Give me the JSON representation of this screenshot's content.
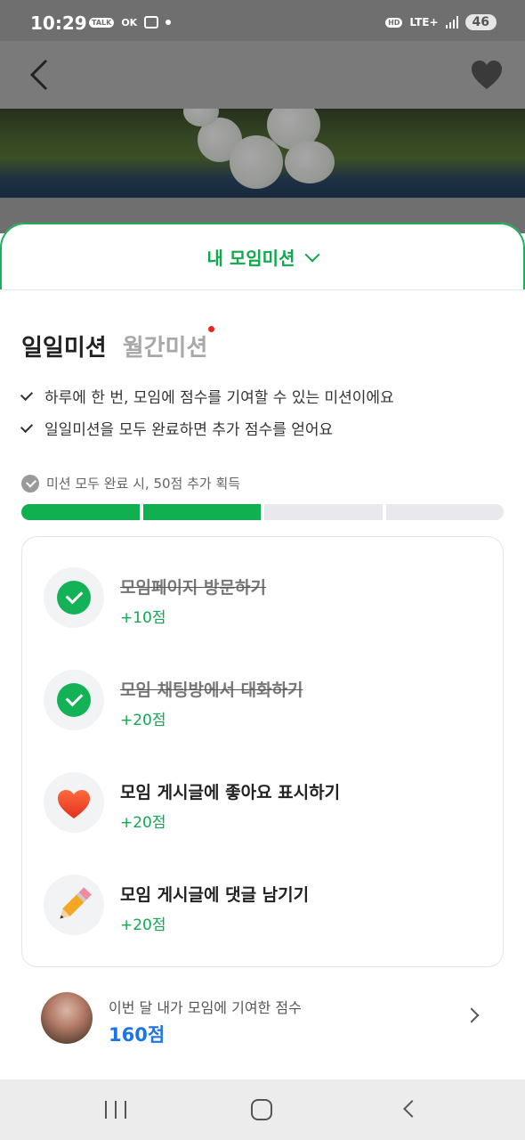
{
  "status_bar": {
    "time": "10:29",
    "left_badges": [
      "TALK",
      "OK"
    ],
    "network": "LTE+",
    "hd": "HD",
    "battery": "46"
  },
  "sheet": {
    "title": "내 모임미션",
    "tabs": [
      {
        "label": "일일미션",
        "active": true
      },
      {
        "label": "월간미션",
        "active": false,
        "has_new": true
      }
    ],
    "notes": [
      "하루에 한 번, 모임에 점수를 기여할 수 있는 미션이에요",
      "일일미션을 모두 완료하면 추가 점수를 얻어요"
    ],
    "bonus_text": "미션 모두 완료 시, 50점 추가 획득",
    "progress": {
      "completed": 2,
      "total": 4
    },
    "missions": [
      {
        "title": "모임페이지 방문하기",
        "points": "+10점",
        "done": true,
        "icon": "check-icon"
      },
      {
        "title": "모임 채팅방에서 대화하기",
        "points": "+20점",
        "done": true,
        "icon": "check-icon"
      },
      {
        "title": "모임 게시글에 좋아요 표시하기",
        "points": "+20점",
        "done": false,
        "icon": "heart-icon"
      },
      {
        "title": "모임 게시글에 댓글 남기기",
        "points": "+20점",
        "done": false,
        "icon": "pencil-icon"
      }
    ],
    "contribution": {
      "label": "이번 달 내가 모임에 기여한 점수",
      "score": "160점"
    }
  },
  "colors": {
    "accent_green": "#10a84c",
    "score_blue": "#1c74e9",
    "dot_red": "#e8261c"
  }
}
